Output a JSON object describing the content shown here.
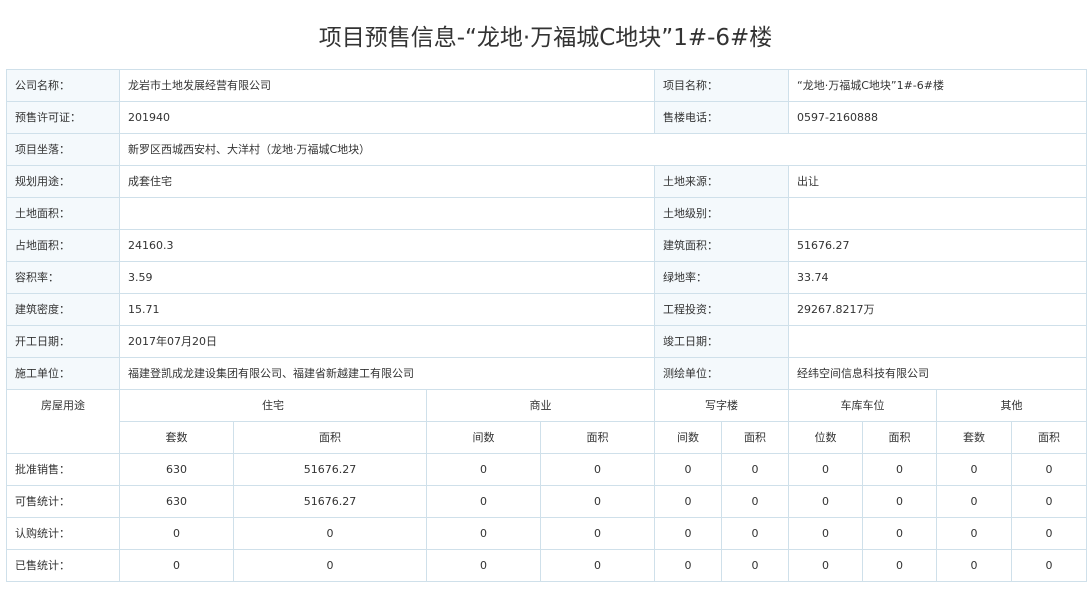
{
  "title": "项目预售信息-“龙地·万福城C地块”1#-6#楼",
  "info": {
    "company_label": "公司名称：",
    "company": "龙岩市土地发展经营有限公司",
    "project_label": "项目名称：",
    "project": "“龙地·万福城C地块”1#-6#楼",
    "permit_label": "预售许可证：",
    "permit": "201940",
    "phone_label": "售楼电话：",
    "phone": "0597-2160888",
    "location_label": "项目坐落：",
    "location": "新罗区西城西安村、大洋村（龙地·万福城C地块）",
    "use_label": "规划用途：",
    "use": "成套住宅",
    "land_source_label": "土地来源：",
    "land_source": "出让",
    "land_area_label": "土地面积：",
    "land_area": "",
    "land_grade_label": "土地级别：",
    "land_grade": "",
    "occupied_area_label": "占地面积：",
    "occupied_area": "24160.3",
    "floor_area_label": "建筑面积：",
    "floor_area": "51676.27",
    "far_label": "容积率：",
    "far": "3.59",
    "green_label": "绿地率：",
    "green": "33.74",
    "density_label": "建筑密度：",
    "density": "15.71",
    "investment_label": "工程投资：",
    "investment": "29267.8217万",
    "start_label": "开工日期：",
    "start": "2017年07月20日",
    "finish_label": "竣工日期：",
    "finish": "",
    "builder_label": "施工单位：",
    "builder": "福建登凯成龙建设集团有限公司、福建省新越建工有限公司",
    "surveyor_label": "测绘单位：",
    "surveyor": "经纬空间信息科技有限公司"
  },
  "stats": {
    "corner": "房屋用途",
    "groups": [
      "住宅",
      "商业",
      "写字楼",
      "车库车位",
      "其他"
    ],
    "subheaders": [
      "套数",
      "面积",
      "间数",
      "面积",
      "间数",
      "面积",
      "位数",
      "面积",
      "套数",
      "面积"
    ],
    "rows": [
      {
        "label": "批准销售：",
        "values": [
          "630",
          "51676.27",
          "0",
          "0",
          "0",
          "0",
          "0",
          "0",
          "0",
          "0"
        ]
      },
      {
        "label": "可售统计：",
        "values": [
          "630",
          "51676.27",
          "0",
          "0",
          "0",
          "0",
          "0",
          "0",
          "0",
          "0"
        ]
      },
      {
        "label": "认购统计：",
        "values": [
          "0",
          "0",
          "0",
          "0",
          "0",
          "0",
          "0",
          "0",
          "0",
          "0"
        ]
      },
      {
        "label": "已售统计：",
        "values": [
          "0",
          "0",
          "0",
          "0",
          "0",
          "0",
          "0",
          "0",
          "0",
          "0"
        ]
      }
    ]
  }
}
